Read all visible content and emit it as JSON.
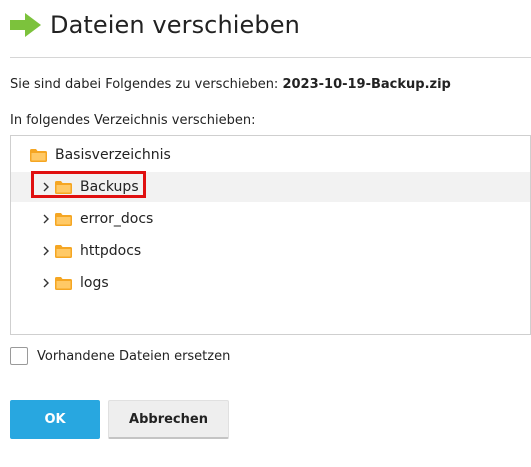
{
  "dialog": {
    "title": "Dateien verschieben",
    "icon": "green-arrow-icon",
    "accent_color": "#7cc23c"
  },
  "move": {
    "prefix": "Sie sind dabei Folgendes zu verschieben: ",
    "filename": "2023-10-19-Backup.zip"
  },
  "directory": {
    "label": "In folgendes Verzeichnis verschieben:",
    "root": "Basisverzeichnis",
    "items": [
      {
        "label": "Backups",
        "selected": true
      },
      {
        "label": "error_docs",
        "selected": false
      },
      {
        "label": "httpdocs",
        "selected": false
      },
      {
        "label": "logs",
        "selected": false
      }
    ],
    "folder_color": "#f5a623"
  },
  "options": {
    "replace_label": "Vorhandene Dateien ersetzen",
    "replace_checked": false
  },
  "buttons": {
    "ok_label": "OK",
    "cancel_label": "Abbrechen",
    "ok_color": "#28a7e0"
  }
}
